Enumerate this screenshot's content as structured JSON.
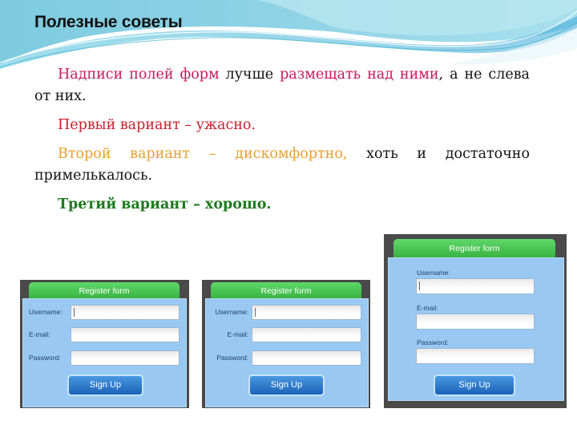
{
  "slide": {
    "title": "Полезные советы"
  },
  "paragraphs": {
    "p1": {
      "part1": "Надписи полей форм",
      "part2": " лучше ",
      "part3": "размещать над ними",
      "part4": ", а не слева от них."
    },
    "p2": "Первый вариант – ужасно.",
    "p3": {
      "part1": "Второй вариант – дискомфортно,",
      "part2": " хоть и достаточно примелькалось."
    },
    "p4": "Третий вариант – хорошо."
  },
  "colors": {
    "highlight_pink": "#c8185e",
    "bad_red": "#c8202e",
    "meh_orange": "#e8a030",
    "good_green": "#1e7a1e",
    "form_tab_green": "#3cbc44",
    "form_body_blue": "#99c9f3",
    "button_blue": "#2a78cc"
  },
  "forms": [
    {
      "variant": "left-aligned labels",
      "header": "Register form",
      "fields": [
        {
          "label": "Username:",
          "value": ""
        },
        {
          "label": "E-mail:",
          "value": ""
        },
        {
          "label": "Password:",
          "value": ""
        }
      ],
      "button": "Sign Up"
    },
    {
      "variant": "right-aligned labels",
      "header": "Register form",
      "fields": [
        {
          "label": "Username:",
          "value": ""
        },
        {
          "label": "E-mail:",
          "value": ""
        },
        {
          "label": "Password:",
          "value": ""
        }
      ],
      "button": "Sign Up"
    },
    {
      "variant": "labels above fields",
      "header": "Register form",
      "fields": [
        {
          "label": "Username:",
          "value": ""
        },
        {
          "label": "E-mail:",
          "value": ""
        },
        {
          "label": "Password:",
          "value": ""
        }
      ],
      "button": "Sign Up"
    }
  ]
}
